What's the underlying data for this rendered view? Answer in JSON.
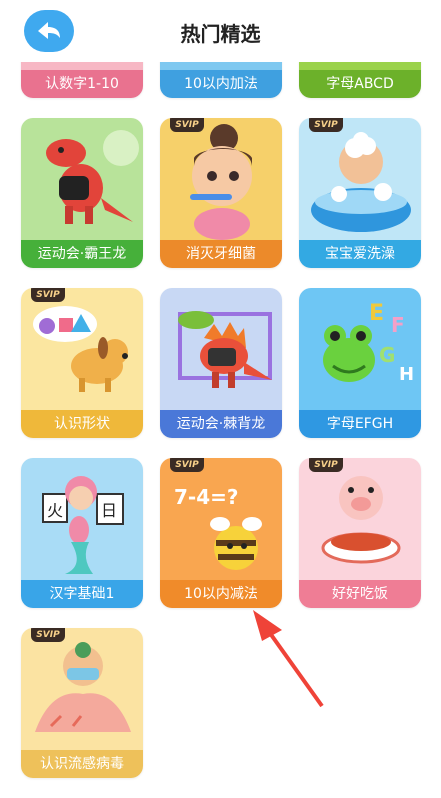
{
  "header": {
    "title": "热门精选"
  },
  "cards": [
    {
      "label": "认数字1-10",
      "svip": "",
      "top_color": "#f7b7c4",
      "label_color": "#e9728f"
    },
    {
      "label": "10以内加法",
      "svip": "",
      "top_color": "#7ec8f0",
      "label_color": "#3fa0e0"
    },
    {
      "label": "字母ABCD",
      "svip": "",
      "top_color": "#9ad24a",
      "label_color": "#6cb12a"
    },
    {
      "label": "运动会·霸王龙",
      "svip": "",
      "top_color": "#b8e39a",
      "label_color": "#46b03a"
    },
    {
      "label": "消灭牙细菌",
      "svip": "SVIP",
      "top_color": "#f6d06a",
      "label_color": "#ec8a2a"
    },
    {
      "label": "宝宝爱洗澡",
      "svip": "SVIP",
      "top_color": "#bfe6f7",
      "label_color": "#33a9e3"
    },
    {
      "label": "认识形状",
      "svip": "SVIP",
      "top_color": "#fbe6a0",
      "label_color": "#efb83a"
    },
    {
      "label": "运动会·棘背龙",
      "svip": "",
      "top_color": "#c8d8f4",
      "label_color": "#4a78d8"
    },
    {
      "label": "字母EFGH",
      "svip": "",
      "top_color": "#6ec6f4",
      "label_color": "#2f98e2"
    },
    {
      "label": "汉字基础1",
      "svip": "",
      "top_color": "#a9dcf6",
      "label_color": "#39a5e8"
    },
    {
      "label": "10以内减法",
      "svip": "SVIP",
      "top_color": "#f9a650",
      "label_color": "#f08b2a"
    },
    {
      "label": "好好吃饭",
      "svip": "SVIP",
      "top_color": "#fbd4dc",
      "label_color": "#ef7d95"
    },
    {
      "label": "认识流感病毒",
      "svip": "SVIP",
      "top_color": "#fbe3a2",
      "label_color": "#eec15a"
    }
  ]
}
